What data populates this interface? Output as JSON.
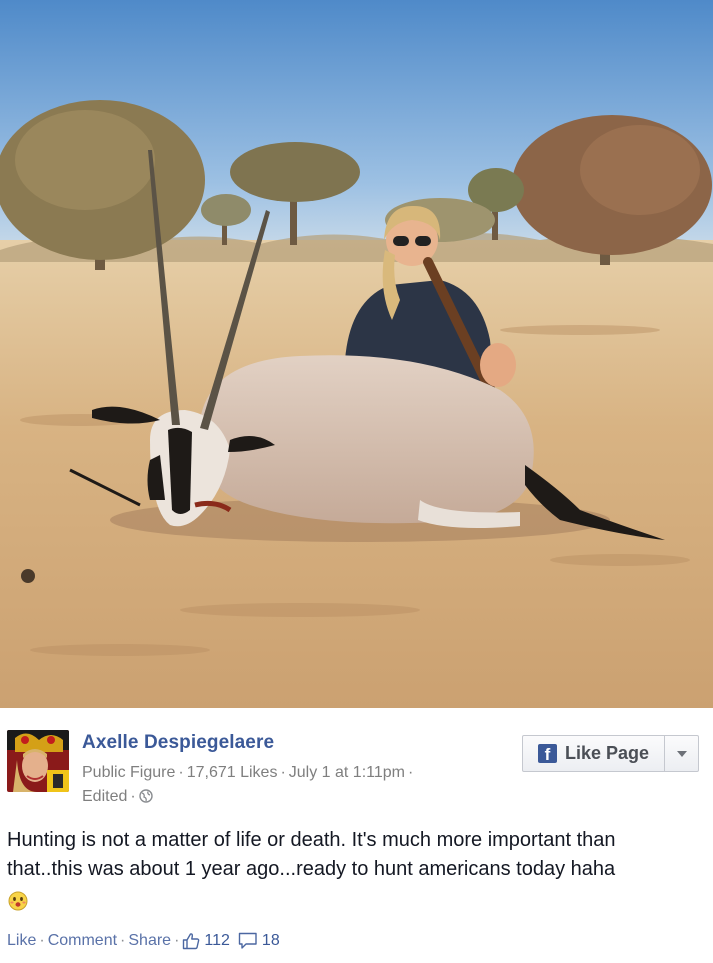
{
  "post": {
    "author": "Axelle Despiegelaere",
    "category": "Public Figure",
    "likes": "17,671 Likes",
    "date": "July 1 at 1:11pm",
    "edited": "Edited",
    "text_line1": "Hunting is not a matter of life or death. It's much more important than",
    "text_line2": "that..this was about 1 year ago...ready to hunt americans today haha"
  },
  "like_page": {
    "fb_glyph": "f",
    "label": "Like Page"
  },
  "actions": {
    "like": "Like",
    "comment": "Comment",
    "share": "Share",
    "like_count": "112",
    "comment_count": "18"
  },
  "icons": {
    "globe": "globe-icon",
    "thumb": "thumbs-up-icon",
    "comment": "comment-bubble-icon",
    "caret": "chevron-down-icon",
    "emoji": "embarrassed-emoji-icon"
  },
  "colors": {
    "link": "#3b5998",
    "meta": "#7f7f7f",
    "fb_blue": "#3b5998"
  }
}
